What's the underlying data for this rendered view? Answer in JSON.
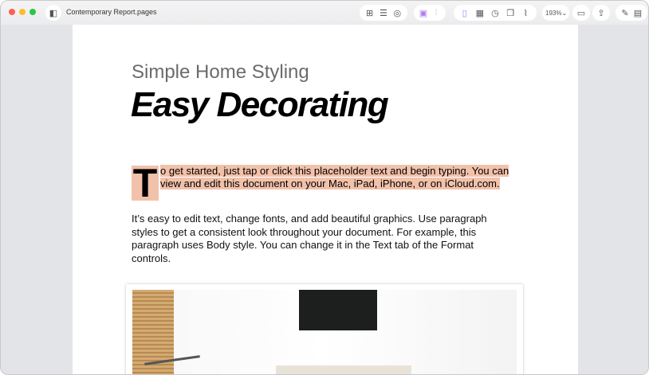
{
  "window": {
    "title": "Contemporary Report.pages",
    "zoom": "193%"
  },
  "toolbar": {
    "icons": [
      "sidebar-icon",
      "insert-icon",
      "text-box-icon",
      "shape-icon",
      "media-icon",
      "chart-icon",
      "page-icon",
      "table-icon",
      "clock-icon",
      "copy-icon",
      "attachment-icon",
      "comment-icon",
      "share-icon",
      "format-icon",
      "document-icon"
    ]
  },
  "doc": {
    "subtitle": "Simple Home Styling",
    "title": "Easy Decorating",
    "drop_cap": "T",
    "para1": "o get started, just tap or click this placeholder text and begin typing. You can view and edit this document on your Mac, iPad, iPhone, or on iCloud.com.",
    "para2": "It’s easy to edit text, change fonts, and add beautiful graphics. Use paragraph styles to get a consistent look throughout your document. For example, this paragraph uses Body style. You can change it in the Text tab of the Format controls."
  },
  "colors": {
    "highlight": "#f2c1aa"
  }
}
